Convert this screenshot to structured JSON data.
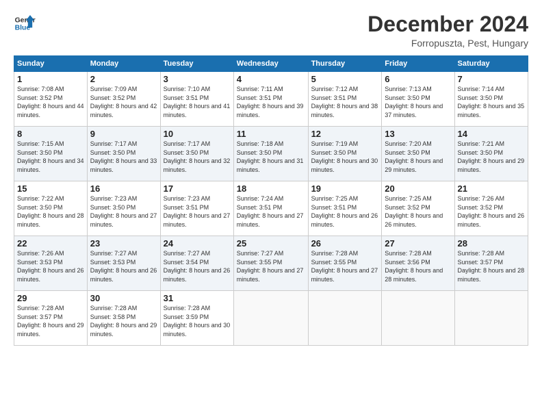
{
  "header": {
    "logo_line1": "General",
    "logo_line2": "Blue",
    "month_title": "December 2024",
    "location": "Forropuszta, Pest, Hungary"
  },
  "weekdays": [
    "Sunday",
    "Monday",
    "Tuesday",
    "Wednesday",
    "Thursday",
    "Friday",
    "Saturday"
  ],
  "weeks": [
    [
      {
        "day": "1",
        "sunrise": "Sunrise: 7:08 AM",
        "sunset": "Sunset: 3:52 PM",
        "daylight": "Daylight: 8 hours and 44 minutes."
      },
      {
        "day": "2",
        "sunrise": "Sunrise: 7:09 AM",
        "sunset": "Sunset: 3:52 PM",
        "daylight": "Daylight: 8 hours and 42 minutes."
      },
      {
        "day": "3",
        "sunrise": "Sunrise: 7:10 AM",
        "sunset": "Sunset: 3:51 PM",
        "daylight": "Daylight: 8 hours and 41 minutes."
      },
      {
        "day": "4",
        "sunrise": "Sunrise: 7:11 AM",
        "sunset": "Sunset: 3:51 PM",
        "daylight": "Daylight: 8 hours and 39 minutes."
      },
      {
        "day": "5",
        "sunrise": "Sunrise: 7:12 AM",
        "sunset": "Sunset: 3:51 PM",
        "daylight": "Daylight: 8 hours and 38 minutes."
      },
      {
        "day": "6",
        "sunrise": "Sunrise: 7:13 AM",
        "sunset": "Sunset: 3:50 PM",
        "daylight": "Daylight: 8 hours and 37 minutes."
      },
      {
        "day": "7",
        "sunrise": "Sunrise: 7:14 AM",
        "sunset": "Sunset: 3:50 PM",
        "daylight": "Daylight: 8 hours and 35 minutes."
      }
    ],
    [
      {
        "day": "8",
        "sunrise": "Sunrise: 7:15 AM",
        "sunset": "Sunset: 3:50 PM",
        "daylight": "Daylight: 8 hours and 34 minutes."
      },
      {
        "day": "9",
        "sunrise": "Sunrise: 7:17 AM",
        "sunset": "Sunset: 3:50 PM",
        "daylight": "Daylight: 8 hours and 33 minutes."
      },
      {
        "day": "10",
        "sunrise": "Sunrise: 7:17 AM",
        "sunset": "Sunset: 3:50 PM",
        "daylight": "Daylight: 8 hours and 32 minutes."
      },
      {
        "day": "11",
        "sunrise": "Sunrise: 7:18 AM",
        "sunset": "Sunset: 3:50 PM",
        "daylight": "Daylight: 8 hours and 31 minutes."
      },
      {
        "day": "12",
        "sunrise": "Sunrise: 7:19 AM",
        "sunset": "Sunset: 3:50 PM",
        "daylight": "Daylight: 8 hours and 30 minutes."
      },
      {
        "day": "13",
        "sunrise": "Sunrise: 7:20 AM",
        "sunset": "Sunset: 3:50 PM",
        "daylight": "Daylight: 8 hours and 29 minutes."
      },
      {
        "day": "14",
        "sunrise": "Sunrise: 7:21 AM",
        "sunset": "Sunset: 3:50 PM",
        "daylight": "Daylight: 8 hours and 29 minutes."
      }
    ],
    [
      {
        "day": "15",
        "sunrise": "Sunrise: 7:22 AM",
        "sunset": "Sunset: 3:50 PM",
        "daylight": "Daylight: 8 hours and 28 minutes."
      },
      {
        "day": "16",
        "sunrise": "Sunrise: 7:23 AM",
        "sunset": "Sunset: 3:50 PM",
        "daylight": "Daylight: 8 hours and 27 minutes."
      },
      {
        "day": "17",
        "sunrise": "Sunrise: 7:23 AM",
        "sunset": "Sunset: 3:51 PM",
        "daylight": "Daylight: 8 hours and 27 minutes."
      },
      {
        "day": "18",
        "sunrise": "Sunrise: 7:24 AM",
        "sunset": "Sunset: 3:51 PM",
        "daylight": "Daylight: 8 hours and 27 minutes."
      },
      {
        "day": "19",
        "sunrise": "Sunrise: 7:25 AM",
        "sunset": "Sunset: 3:51 PM",
        "daylight": "Daylight: 8 hours and 26 minutes."
      },
      {
        "day": "20",
        "sunrise": "Sunrise: 7:25 AM",
        "sunset": "Sunset: 3:52 PM",
        "daylight": "Daylight: 8 hours and 26 minutes."
      },
      {
        "day": "21",
        "sunrise": "Sunrise: 7:26 AM",
        "sunset": "Sunset: 3:52 PM",
        "daylight": "Daylight: 8 hours and 26 minutes."
      }
    ],
    [
      {
        "day": "22",
        "sunrise": "Sunrise: 7:26 AM",
        "sunset": "Sunset: 3:53 PM",
        "daylight": "Daylight: 8 hours and 26 minutes."
      },
      {
        "day": "23",
        "sunrise": "Sunrise: 7:27 AM",
        "sunset": "Sunset: 3:53 PM",
        "daylight": "Daylight: 8 hours and 26 minutes."
      },
      {
        "day": "24",
        "sunrise": "Sunrise: 7:27 AM",
        "sunset": "Sunset: 3:54 PM",
        "daylight": "Daylight: 8 hours and 26 minutes."
      },
      {
        "day": "25",
        "sunrise": "Sunrise: 7:27 AM",
        "sunset": "Sunset: 3:55 PM",
        "daylight": "Daylight: 8 hours and 27 minutes."
      },
      {
        "day": "26",
        "sunrise": "Sunrise: 7:28 AM",
        "sunset": "Sunset: 3:55 PM",
        "daylight": "Daylight: 8 hours and 27 minutes."
      },
      {
        "day": "27",
        "sunrise": "Sunrise: 7:28 AM",
        "sunset": "Sunset: 3:56 PM",
        "daylight": "Daylight: 8 hours and 28 minutes."
      },
      {
        "day": "28",
        "sunrise": "Sunrise: 7:28 AM",
        "sunset": "Sunset: 3:57 PM",
        "daylight": "Daylight: 8 hours and 28 minutes."
      }
    ],
    [
      {
        "day": "29",
        "sunrise": "Sunrise: 7:28 AM",
        "sunset": "Sunset: 3:57 PM",
        "daylight": "Daylight: 8 hours and 29 minutes."
      },
      {
        "day": "30",
        "sunrise": "Sunrise: 7:28 AM",
        "sunset": "Sunset: 3:58 PM",
        "daylight": "Daylight: 8 hours and 29 minutes."
      },
      {
        "day": "31",
        "sunrise": "Sunrise: 7:28 AM",
        "sunset": "Sunset: 3:59 PM",
        "daylight": "Daylight: 8 hours and 30 minutes."
      },
      null,
      null,
      null,
      null
    ]
  ]
}
